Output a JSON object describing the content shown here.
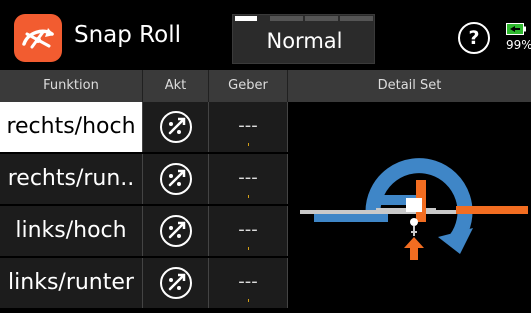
{
  "header": {
    "title": "Snap Roll",
    "mode": "Normal",
    "help": "?",
    "battery_percent": "99%"
  },
  "columns": [
    "Funktion",
    "Akt",
    "Geber",
    "Detail Set"
  ],
  "rows": [
    {
      "funktion": "rechts/hoch",
      "geber": "---",
      "selected": true
    },
    {
      "funktion": "rechts/run..",
      "geber": "---",
      "selected": false
    },
    {
      "funktion": "links/hoch",
      "geber": "---",
      "selected": false
    },
    {
      "funktion": "links/runter",
      "geber": "---",
      "selected": false
    }
  ],
  "icons": {
    "app": "snap-roll-app-icon",
    "help": "help-icon",
    "battery": "battery-icon",
    "switch": "switch-icon",
    "detail": "snap-roll-airplane-illustration"
  },
  "colors": {
    "accent": "#f25c30",
    "selected_row": "#ffffff",
    "header_bar": "#3a3a3a",
    "cell_bg": "#1c1c1c",
    "rotation_arrow": "#3f86c7",
    "battery_green": "#2eb82e"
  }
}
